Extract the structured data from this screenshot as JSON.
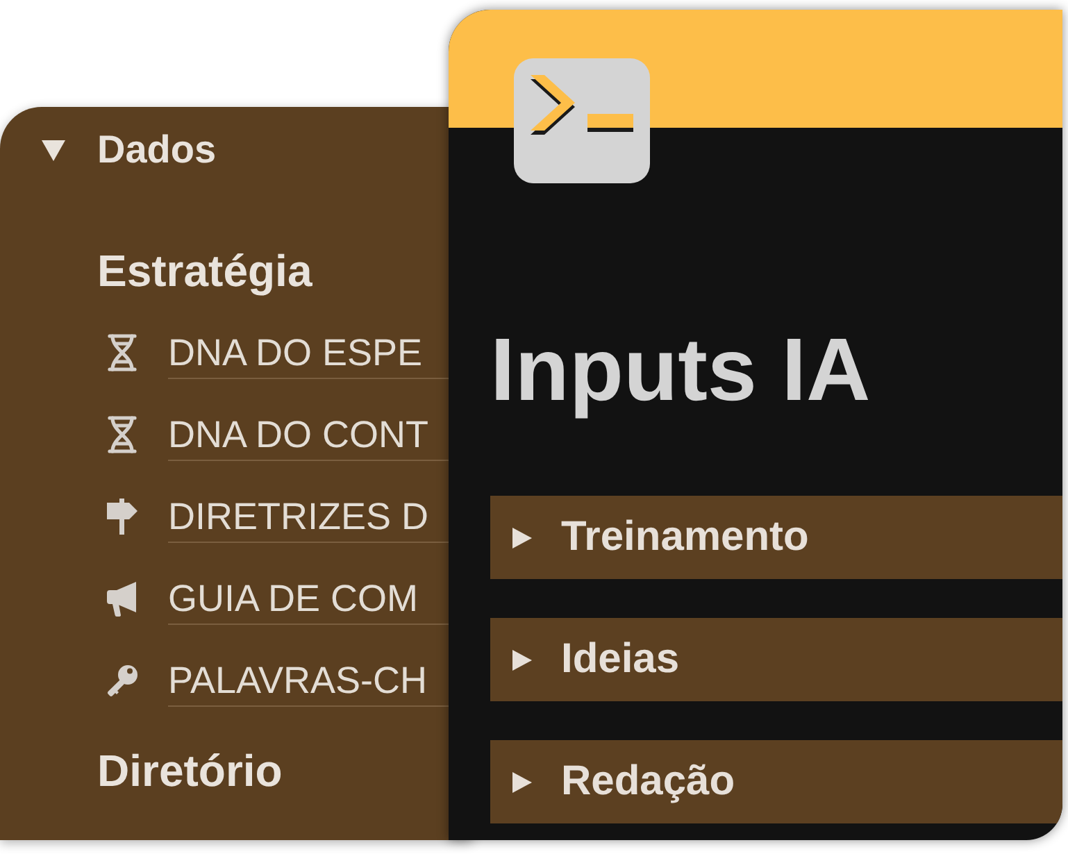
{
  "back_page": {
    "toggle": {
      "label": "Dados",
      "expanded": true,
      "sections": [
        {
          "heading": "Estratégia",
          "links": [
            {
              "kind": "dna",
              "label": "DNA DO ESPE"
            },
            {
              "kind": "dna",
              "label": "DNA DO CONT"
            },
            {
              "kind": "signpost",
              "label": "DIRETRIZES D"
            },
            {
              "kind": "megaphone",
              "label": "GUIA DE COM"
            },
            {
              "kind": "key",
              "label": "PALAVRAS-CH"
            }
          ]
        },
        {
          "heading": "Diretório"
        }
      ]
    }
  },
  "front_page": {
    "title": "Inputs IA",
    "toggles": [
      {
        "label": "Treinamento",
        "expanded": false
      },
      {
        "label": "Ideias",
        "expanded": false
      },
      {
        "label": "Redação",
        "expanded": false
      }
    ]
  }
}
